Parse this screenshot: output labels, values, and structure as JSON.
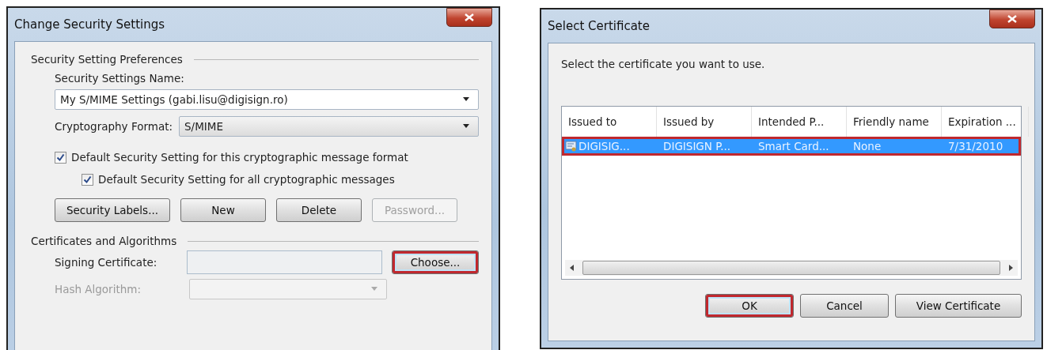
{
  "security_dialog": {
    "title": "Change Security Settings",
    "preferences": {
      "heading": "Security Setting Preferences",
      "name_label": "Security Settings Name:",
      "name_value": "My S/MIME Settings (gabi.lisu@digisign.ro)",
      "format_label": "Cryptography Format:",
      "format_value": "S/MIME",
      "checkboxes": [
        {
          "label": "Default Security Setting for this cryptographic message format",
          "checked": true,
          "children": [
            {
              "label": "Default Security Setting for all cryptographic messages",
              "checked": true
            }
          ]
        }
      ],
      "buttons": [
        {
          "label": "Security Labels...",
          "disabled": false
        },
        {
          "label": "New",
          "disabled": false
        },
        {
          "label": "Delete",
          "disabled": false
        },
        {
          "label": "Password...",
          "disabled": true
        }
      ]
    },
    "certificates": {
      "heading": "Certificates and Algorithms",
      "signing_label": "Signing Certificate:",
      "choose_button": {
        "label": "Choose...",
        "highlighted": true
      },
      "hash_label": "Hash Algorithm:",
      "hash_disabled": true
    }
  },
  "certificate_dialog": {
    "title": "Select Certificate",
    "prompt": "Select the certificate you want to use.",
    "columns": [
      "Issued to",
      "Issued by",
      "Intended P...",
      "Friendly name",
      "Expiration ..."
    ],
    "rows": [
      {
        "cells": [
          "DIGISIG...",
          "DIGISIGN P...",
          "Smart Card...",
          "None",
          "7/31/2010"
        ],
        "selected": true,
        "highlighted": true
      }
    ],
    "buttons": [
      {
        "label": "OK",
        "highlighted": true
      },
      {
        "label": "Cancel",
        "highlighted": false
      },
      {
        "label": "View Certificate",
        "highlighted": false
      }
    ]
  }
}
